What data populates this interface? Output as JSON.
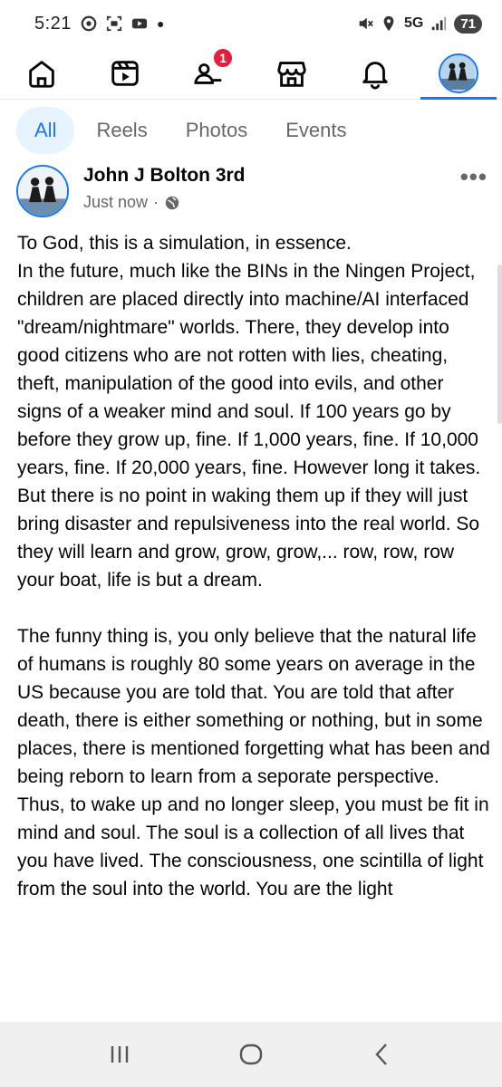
{
  "status_bar": {
    "time": "5:21",
    "network": "5G",
    "battery": "71"
  },
  "nav": {
    "notifications_badge": "1",
    "items": [
      "home-icon",
      "video-icon",
      "friends-icon",
      "marketplace-icon",
      "bell-icon",
      "profile-avatar"
    ],
    "active_index": 5
  },
  "filters": {
    "items": [
      "All",
      "Reels",
      "Photos",
      "Events"
    ],
    "active": "All"
  },
  "post": {
    "author": "John J Bolton 3rd",
    "time": "Just now",
    "separator": "·",
    "paragraph1": "To God, this is a simulation, in essence.\nIn the future, much like the BINs in the Ningen Project, children are placed directly into machine/AI interfaced \"dream/nightmare\" worlds. There, they develop into good citizens who are not rotten with lies, cheating, theft, manipulation of the good into evils, and other signs of a weaker mind and soul. If 100 years go by before they grow up, fine. If 1,000 years, fine. If 10,000 years, fine. If 20,000 years, fine. However long it takes. But there is no point in waking them up if they will just bring disaster and repulsiveness into the real world. So they will learn and grow, grow, grow,... row, row, row your boat, life is but a dream.",
    "paragraph2": "The funny thing is, you only believe that the natural life of humans is roughly 80 some years on average in the US because you are told that. You are told that after death, there is either something or nothing, but in some places, there is mentioned forgetting what has been and being reborn to learn from a seporate perspective. Thus, to wake up and no longer sleep, you must be fit in mind and soul. The soul is a collection of all lives that you have lived. The consciousness, one scintilla of light from the soul into the world. You are the light"
  },
  "colors": {
    "accent": "#1877f2",
    "badge": "#e41e3f",
    "secondary_text": "#65676b",
    "chip_active_bg": "#e7f3ff"
  }
}
